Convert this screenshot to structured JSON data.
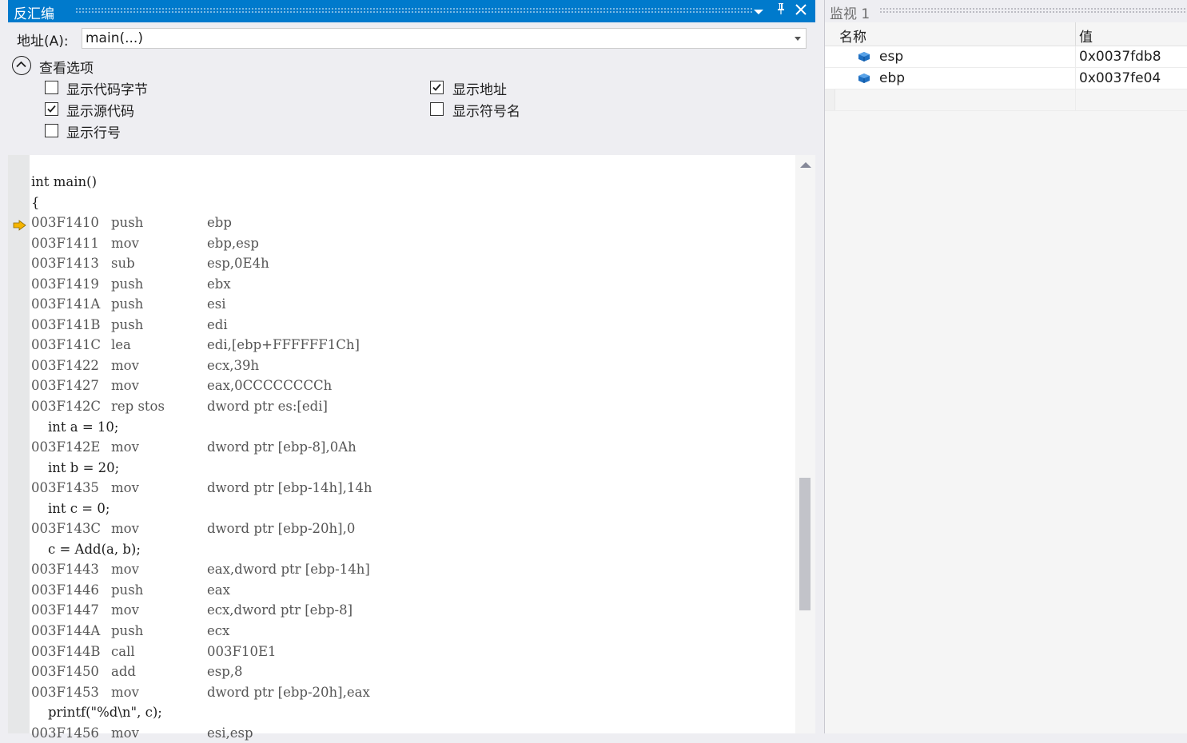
{
  "disasm": {
    "title": "反汇编",
    "address_label": "地址(A):",
    "address_value": "main(...)",
    "options_title": "查看选项",
    "options": [
      {
        "label": "显示代码字节",
        "checked": false
      },
      {
        "label": "显示源代码",
        "checked": true
      },
      {
        "label": "显示行号",
        "checked": false
      },
      {
        "label": "显示地址",
        "checked": true
      },
      {
        "label": "显示符号名",
        "checked": false
      }
    ],
    "lines": [
      {
        "src": "int main()"
      },
      {
        "src": "{"
      },
      {
        "addr": "003F1410",
        "mn": "push",
        "op": "ebp"
      },
      {
        "addr": "003F1411",
        "mn": "mov",
        "op": "ebp,esp"
      },
      {
        "addr": "003F1413",
        "mn": "sub",
        "op": "esp,0E4h"
      },
      {
        "addr": "003F1419",
        "mn": "push",
        "op": "ebx"
      },
      {
        "addr": "003F141A",
        "mn": "push",
        "op": "esi"
      },
      {
        "addr": "003F141B",
        "mn": "push",
        "op": "edi"
      },
      {
        "addr": "003F141C",
        "mn": "lea",
        "op": "edi,[ebp+FFFFFF1Ch]"
      },
      {
        "addr": "003F1422",
        "mn": "mov",
        "op": "ecx,39h"
      },
      {
        "addr": "003F1427",
        "mn": "mov",
        "op": "eax,0CCCCCCCCh"
      },
      {
        "addr": "003F142C",
        "mn": "rep stos",
        "op": "dword ptr es:[edi]"
      },
      {
        "src": "    int a = 10;"
      },
      {
        "addr": "003F142E",
        "mn": "mov",
        "op": "dword ptr [ebp-8],0Ah"
      },
      {
        "src": "    int b = 20;"
      },
      {
        "addr": "003F1435",
        "mn": "mov",
        "op": "dword ptr [ebp-14h],14h"
      },
      {
        "src": "    int c = 0;"
      },
      {
        "addr": "003F143C",
        "mn": "mov",
        "op": "dword ptr [ebp-20h],0"
      },
      {
        "src": "    c = Add(a, b);"
      },
      {
        "addr": "003F1443",
        "mn": "mov",
        "op": "eax,dword ptr [ebp-14h]"
      },
      {
        "addr": "003F1446",
        "mn": "push",
        "op": "eax"
      },
      {
        "addr": "003F1447",
        "mn": "mov",
        "op": "ecx,dword ptr [ebp-8]"
      },
      {
        "addr": "003F144A",
        "mn": "push",
        "op": "ecx"
      },
      {
        "addr": "003F144B",
        "mn": "call",
        "op": "003F10E1"
      },
      {
        "addr": "003F1450",
        "mn": "add",
        "op": "esp,8"
      },
      {
        "addr": "003F1453",
        "mn": "mov",
        "op": "dword ptr [ebp-20h],eax"
      },
      {
        "src": "    printf(\"%d\\n\", c);"
      },
      {
        "addr": "003F1456",
        "mn": "mov",
        "op": "esi,esp"
      }
    ]
  },
  "watch": {
    "title": "监视 1",
    "col_name": "名称",
    "col_value": "值",
    "rows": [
      {
        "name": "esp",
        "value": "0x0037fdb8"
      },
      {
        "name": "ebp",
        "value": "0x0037fe04"
      }
    ]
  },
  "colors": {
    "accent": "#007acc",
    "ip_arrow": "#f5b400",
    "var_icon": "#1f6fc1"
  },
  "icons": [
    "dropdown-arrow-icon",
    "pin-icon",
    "close-icon",
    "collapse-up-icon",
    "checkmark-icon",
    "instruction-pointer-icon",
    "variable-icon"
  ]
}
